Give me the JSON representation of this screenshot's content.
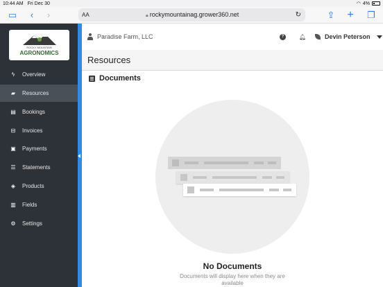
{
  "status": {
    "time": "10:44 AM",
    "date": "Fri Dec 30",
    "battery": "4%"
  },
  "browser": {
    "aa_label": "AA",
    "url": "rockymountainag.grower360.net"
  },
  "brand": {
    "line1": "ROCKY MOUNTAIN",
    "line2": "AGRONOMICS",
    "accent": "#2f8be6"
  },
  "sidebar": {
    "items": [
      {
        "label": "Overview",
        "icon": "bolt-icon"
      },
      {
        "label": "Resources",
        "icon": "folder-icon"
      },
      {
        "label": "Bookings",
        "icon": "book-icon"
      },
      {
        "label": "Invoices",
        "icon": "inbox-icon"
      },
      {
        "label": "Payments",
        "icon": "payments-icon"
      },
      {
        "label": "Statements",
        "icon": "list-icon"
      },
      {
        "label": "Products",
        "icon": "box-icon"
      },
      {
        "label": "Fields",
        "icon": "map-icon"
      },
      {
        "label": "Settings",
        "icon": "gear-icon"
      }
    ],
    "active": "Resources"
  },
  "header": {
    "farm": "Paradise Farm, LLC",
    "user": "Devin Peterson"
  },
  "page": {
    "title": "Resources",
    "section": "Documents"
  },
  "empty": {
    "title": "No Documents",
    "subtitle": "Documents will display here when they are available"
  }
}
